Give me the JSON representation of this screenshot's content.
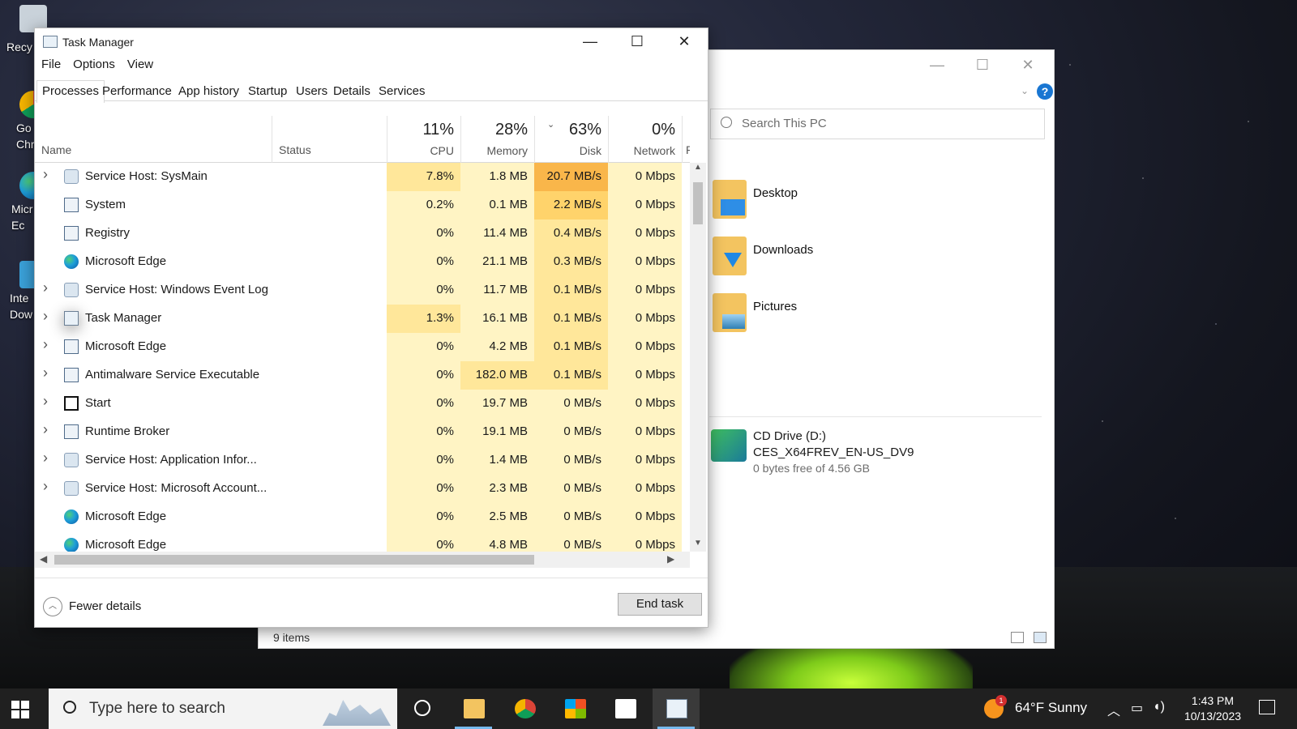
{
  "desktop": {
    "icons": [
      {
        "label": "Recy"
      },
      {
        "label": "Go\nChr"
      },
      {
        "label": "Micr\nEc"
      },
      {
        "label": "Inte\nDow"
      }
    ]
  },
  "explorer": {
    "search_placeholder": "Search This PC",
    "help_label": "?",
    "folders": [
      "Desktop",
      "Downloads",
      "Pictures"
    ],
    "drive": {
      "name": "CD Drive (D:)",
      "label": "CES_X64FREV_EN-US_DV9",
      "free": "0 bytes free of 4.56 GB"
    },
    "status": "9 items"
  },
  "task_manager": {
    "title": "Task Manager",
    "menu": [
      "File",
      "Options",
      "View"
    ],
    "tabs": [
      "Processes",
      "Performance",
      "App history",
      "Startup",
      "Users",
      "Details",
      "Services"
    ],
    "active_tab": "Processes",
    "columns": {
      "name": "Name",
      "status": "Status",
      "cpu": {
        "pct": "11%",
        "label": "CPU"
      },
      "memory": {
        "pct": "28%",
        "label": "Memory"
      },
      "disk": {
        "pct": "63%",
        "label": "Disk"
      },
      "network": {
        "pct": "0%",
        "label": "Network"
      },
      "power_cut": "Po"
    },
    "processes": [
      {
        "expand": true,
        "icon": "gear",
        "name": "Service Host: SysMain",
        "cpu": "7.8%",
        "memory": "1.8 MB",
        "disk": "20.7 MB/s",
        "network": "0 Mbps"
      },
      {
        "expand": false,
        "icon": "win",
        "name": "System",
        "cpu": "0.2%",
        "memory": "0.1 MB",
        "disk": "2.2 MB/s",
        "network": "0 Mbps"
      },
      {
        "expand": false,
        "icon": "win",
        "name": "Registry",
        "cpu": "0%",
        "memory": "11.4 MB",
        "disk": "0.4 MB/s",
        "network": "0 Mbps"
      },
      {
        "expand": false,
        "icon": "edge",
        "name": "Microsoft Edge",
        "cpu": "0%",
        "memory": "21.1 MB",
        "disk": "0.3 MB/s",
        "network": "0 Mbps"
      },
      {
        "expand": true,
        "icon": "gear",
        "name": "Service Host: Windows Event Log",
        "cpu": "0%",
        "memory": "11.7 MB",
        "disk": "0.1 MB/s",
        "network": "0 Mbps"
      },
      {
        "expand": true,
        "icon": "tm",
        "name": "Task Manager",
        "cpu": "1.3%",
        "memory": "16.1 MB",
        "disk": "0.1 MB/s",
        "network": "0 Mbps"
      },
      {
        "expand": true,
        "icon": "win",
        "name": "Microsoft Edge",
        "cpu": "0%",
        "memory": "4.2 MB",
        "disk": "0.1 MB/s",
        "network": "0 Mbps"
      },
      {
        "expand": true,
        "icon": "win",
        "name": "Antimalware Service Executable",
        "cpu": "0%",
        "memory": "182.0 MB",
        "disk": "0.1 MB/s",
        "network": "0 Mbps"
      },
      {
        "expand": true,
        "icon": "start",
        "name": "Start",
        "cpu": "0%",
        "memory": "19.7 MB",
        "disk": "0 MB/s",
        "network": "0 Mbps"
      },
      {
        "expand": true,
        "icon": "win",
        "name": "Runtime Broker",
        "cpu": "0%",
        "memory": "19.1 MB",
        "disk": "0 MB/s",
        "network": "0 Mbps"
      },
      {
        "expand": true,
        "icon": "gear",
        "name": "Service Host: Application Infor...",
        "cpu": "0%",
        "memory": "1.4 MB",
        "disk": "0 MB/s",
        "network": "0 Mbps"
      },
      {
        "expand": true,
        "icon": "gear",
        "name": "Service Host: Microsoft Account...",
        "cpu": "0%",
        "memory": "2.3 MB",
        "disk": "0 MB/s",
        "network": "0 Mbps"
      },
      {
        "expand": false,
        "icon": "edge",
        "name": "Microsoft Edge",
        "cpu": "0%",
        "memory": "2.5 MB",
        "disk": "0 MB/s",
        "network": "0 Mbps"
      },
      {
        "expand": false,
        "icon": "edge",
        "name": "Microsoft Edge",
        "cpu": "0%",
        "memory": "4.8 MB",
        "disk": "0 MB/s",
        "network": "0 Mbps"
      }
    ],
    "fewer_details": "Fewer details",
    "end_task": "End task"
  },
  "taskbar": {
    "search_placeholder": "Type here to search",
    "weather_badge": "1",
    "weather": "64°F  Sunny",
    "time": "1:43 PM",
    "date": "10/13/2023"
  },
  "colors": {
    "heat_light": "#fff4c4",
    "heat_mid": "#ffe79a",
    "heat_strong": "#ffd36b",
    "heat_hot": "#f9b64a",
    "taskbar": "#202020"
  }
}
